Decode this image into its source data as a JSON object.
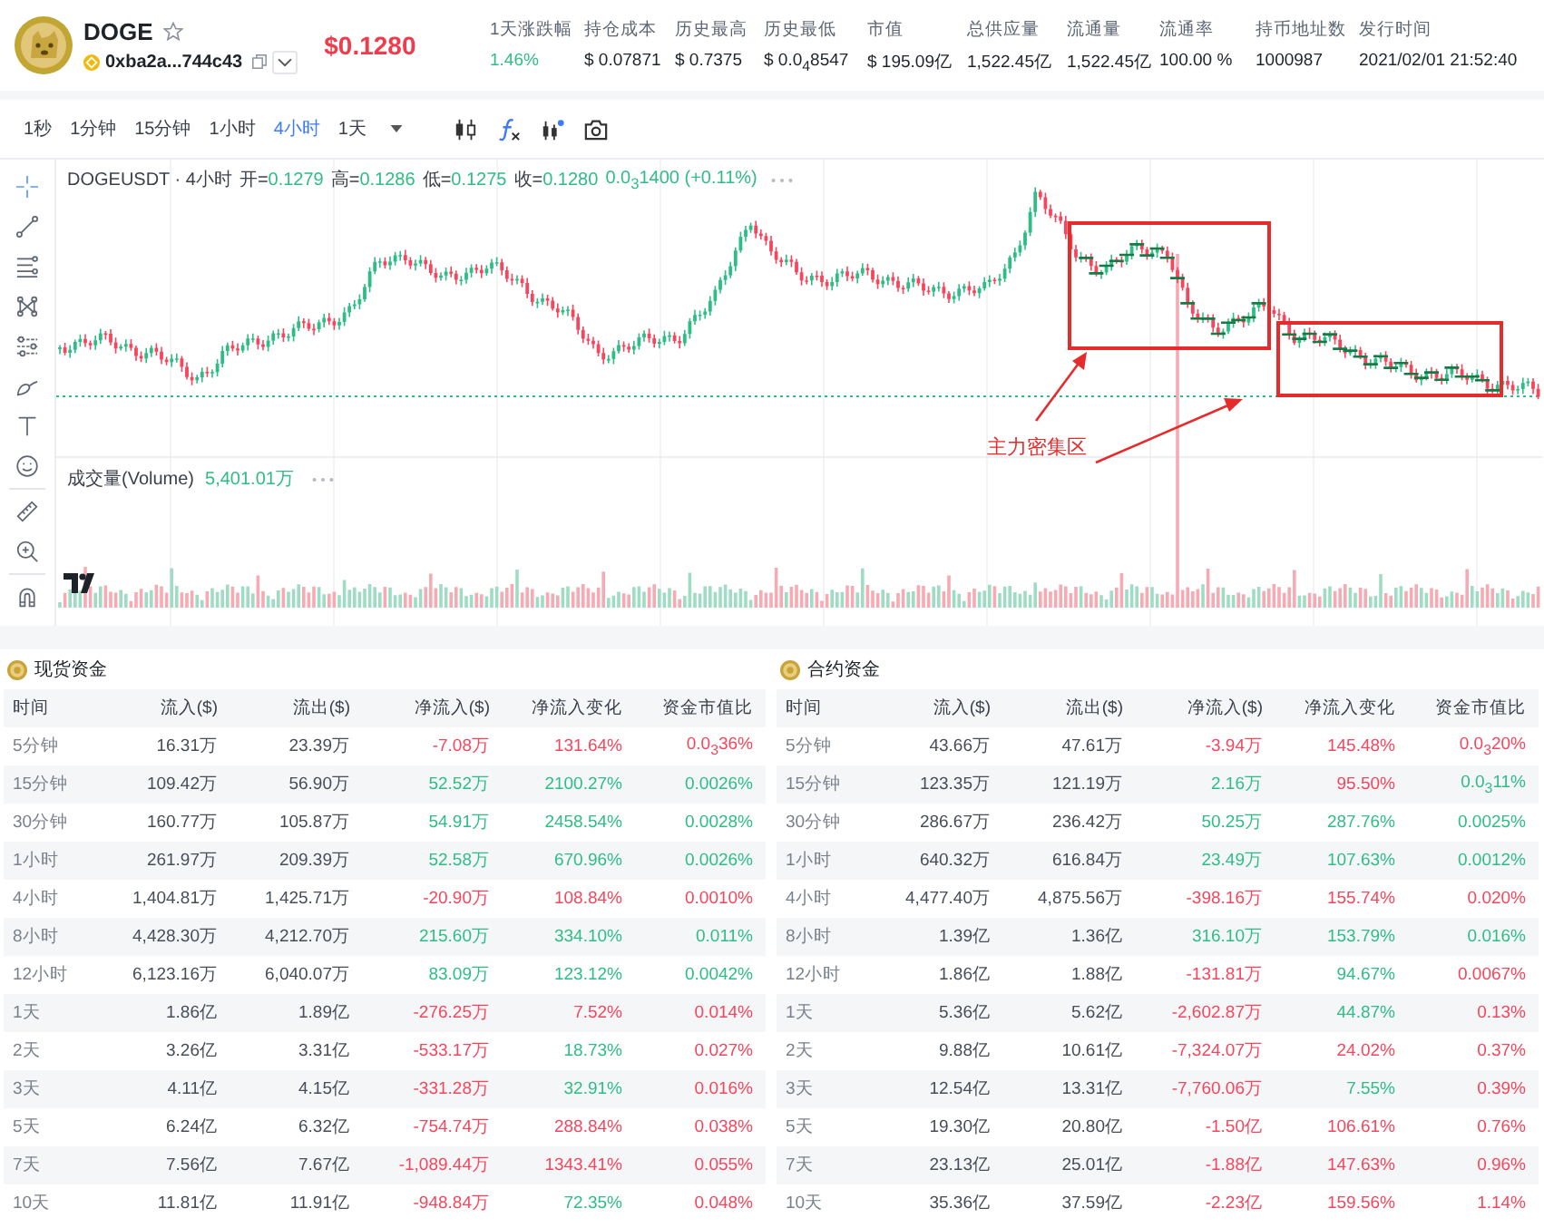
{
  "coin": {
    "symbol": "DOGE",
    "address": "0xba2a...744c43",
    "price": "$0.1280"
  },
  "stats": [
    {
      "label": "1天涨跌幅",
      "value": "1.46%",
      "color": "#2ebd85"
    },
    {
      "label": "持仓成本",
      "value": "$ 0.07871",
      "color": "#1e2329"
    },
    {
      "label": "历史最高",
      "value": "$ 0.7375",
      "color": "#1e2329"
    },
    {
      "label": "历史最低",
      "value": "$ 0.0$_{4}$8547",
      "color": "#1e2329"
    },
    {
      "label": "市值",
      "value": "$ 195.09亿",
      "color": "#1e2329"
    },
    {
      "label": "总供应量",
      "value": "1,522.45亿",
      "color": "#1e2329"
    },
    {
      "label": "流通量",
      "value": "1,522.45亿",
      "color": "#1e2329"
    },
    {
      "label": "流通率",
      "value": "100.00 %",
      "color": "#1e2329"
    },
    {
      "label": "持币地址数",
      "value": "1000987",
      "color": "#1e2329"
    },
    {
      "label": "发行时间",
      "value": "2021/02/01 21:52:40",
      "color": "#1e2329"
    }
  ],
  "intervals": [
    {
      "label": "1秒",
      "selected": false
    },
    {
      "label": "1分钟",
      "selected": false
    },
    {
      "label": "15分钟",
      "selected": false
    },
    {
      "label": "1小时",
      "selected": false
    },
    {
      "label": "4小时",
      "selected": true
    },
    {
      "label": "1天",
      "selected": false
    }
  ],
  "drawing_tools": [
    {
      "kind": "crosshair",
      "selected": true
    },
    {
      "kind": "trend_line",
      "selected": false
    },
    {
      "kind": "parallel_lines",
      "selected": false
    },
    {
      "kind": "pattern",
      "selected": false
    },
    {
      "kind": "sliders",
      "selected": false
    },
    {
      "kind": "brush",
      "selected": false
    },
    {
      "kind": "text",
      "selected": false
    },
    {
      "kind": "emoji",
      "selected": false
    },
    {
      "kind": "ruler",
      "selected": false
    },
    {
      "kind": "zoom",
      "selected": false
    },
    {
      "kind": "magnet",
      "selected": false
    }
  ],
  "chart": {
    "legend": {
      "symbol": "DOGEUSDT · 4小时",
      "fields": [
        {
          "label": "开=",
          "value": "0.1279"
        },
        {
          "label": "高=",
          "value": "0.1286"
        },
        {
          "label": "低=",
          "value": "0.1275"
        },
        {
          "label": "收=",
          "value": "0.1280"
        }
      ],
      "change": "0.0$_{3}$1400 (+0.11%)"
    },
    "volume": {
      "label": "成交量(Volume)",
      "value": "5,401.01万"
    },
    "annotation": "主力密集区"
  },
  "tables": [
    {
      "title": "现货资金",
      "columns": [
        "时间",
        "流入($)",
        "流出($)",
        "净流入($)",
        "净流入变化",
        "资金市值比"
      ],
      "rows": [
        {
          "time": "5分钟",
          "inflow": "16.31万",
          "outflow": "23.39万",
          "net": {
            "text": "-7.08万",
            "color": "#f6465d"
          },
          "change": {
            "text": "131.64%",
            "color": "#f6465d"
          },
          "ratio": {
            "text": "0.0$_{3}$36%",
            "color": "#f6465d"
          }
        },
        {
          "time": "15分钟",
          "inflow": "109.42万",
          "outflow": "56.90万",
          "net": {
            "text": "52.52万",
            "color": "#2ebd85"
          },
          "change": {
            "text": "2100.27%",
            "color": "#2ebd85"
          },
          "ratio": {
            "text": "0.0026%",
            "color": "#2ebd85"
          }
        },
        {
          "time": "30分钟",
          "inflow": "160.77万",
          "outflow": "105.87万",
          "net": {
            "text": "54.91万",
            "color": "#2ebd85"
          },
          "change": {
            "text": "2458.54%",
            "color": "#2ebd85"
          },
          "ratio": {
            "text": "0.0028%",
            "color": "#2ebd85"
          }
        },
        {
          "time": "1小时",
          "inflow": "261.97万",
          "outflow": "209.39万",
          "net": {
            "text": "52.58万",
            "color": "#2ebd85"
          },
          "change": {
            "text": "670.96%",
            "color": "#2ebd85"
          },
          "ratio": {
            "text": "0.0026%",
            "color": "#2ebd85"
          }
        },
        {
          "time": "4小时",
          "inflow": "1,404.81万",
          "outflow": "1,425.71万",
          "net": {
            "text": "-20.90万",
            "color": "#f6465d"
          },
          "change": {
            "text": "108.84%",
            "color": "#f6465d"
          },
          "ratio": {
            "text": "0.0010%",
            "color": "#f6465d"
          }
        },
        {
          "time": "8小时",
          "inflow": "4,428.30万",
          "outflow": "4,212.70万",
          "net": {
            "text": "215.60万",
            "color": "#2ebd85"
          },
          "change": {
            "text": "334.10%",
            "color": "#2ebd85"
          },
          "ratio": {
            "text": "0.011%",
            "color": "#2ebd85"
          }
        },
        {
          "time": "12小时",
          "inflow": "6,123.16万",
          "outflow": "6,040.07万",
          "net": {
            "text": "83.09万",
            "color": "#2ebd85"
          },
          "change": {
            "text": "123.12%",
            "color": "#2ebd85"
          },
          "ratio": {
            "text": "0.0042%",
            "color": "#2ebd85"
          }
        },
        {
          "time": "1天",
          "inflow": "1.86亿",
          "outflow": "1.89亿",
          "net": {
            "text": "-276.25万",
            "color": "#f6465d"
          },
          "change": {
            "text": "7.52%",
            "color": "#f6465d"
          },
          "ratio": {
            "text": "0.014%",
            "color": "#f6465d"
          }
        },
        {
          "time": "2天",
          "inflow": "3.26亿",
          "outflow": "3.31亿",
          "net": {
            "text": "-533.17万",
            "color": "#f6465d"
          },
          "change": {
            "text": "18.73%",
            "color": "#2ebd85"
          },
          "ratio": {
            "text": "0.027%",
            "color": "#f6465d"
          }
        },
        {
          "time": "3天",
          "inflow": "4.11亿",
          "outflow": "4.15亿",
          "net": {
            "text": "-331.28万",
            "color": "#f6465d"
          },
          "change": {
            "text": "32.91%",
            "color": "#2ebd85"
          },
          "ratio": {
            "text": "0.016%",
            "color": "#f6465d"
          }
        },
        {
          "time": "5天",
          "inflow": "6.24亿",
          "outflow": "6.32亿",
          "net": {
            "text": "-754.74万",
            "color": "#f6465d"
          },
          "change": {
            "text": "288.84%",
            "color": "#f6465d"
          },
          "ratio": {
            "text": "0.038%",
            "color": "#f6465d"
          }
        },
        {
          "time": "7天",
          "inflow": "7.56亿",
          "outflow": "7.67亿",
          "net": {
            "text": "-1,089.44万",
            "color": "#f6465d"
          },
          "change": {
            "text": "1343.41%",
            "color": "#f6465d"
          },
          "ratio": {
            "text": "0.055%",
            "color": "#f6465d"
          }
        },
        {
          "time": "10天",
          "inflow": "11.81亿",
          "outflow": "11.91亿",
          "net": {
            "text": "-948.84万",
            "color": "#f6465d"
          },
          "change": {
            "text": "72.35%",
            "color": "#2ebd85"
          },
          "ratio": {
            "text": "0.048%",
            "color": "#f6465d"
          }
        }
      ]
    },
    {
      "title": "合约资金",
      "columns": [
        "时间",
        "流入($)",
        "流出($)",
        "净流入($)",
        "净流入变化",
        "资金市值比"
      ],
      "rows": [
        {
          "time": "5分钟",
          "inflow": "43.66万",
          "outflow": "47.61万",
          "net": {
            "text": "-3.94万",
            "color": "#f6465d"
          },
          "change": {
            "text": "145.48%",
            "color": "#f6465d"
          },
          "ratio": {
            "text": "0.0$_{3}$20%",
            "color": "#f6465d"
          }
        },
        {
          "time": "15分钟",
          "inflow": "123.35万",
          "outflow": "121.19万",
          "net": {
            "text": "2.16万",
            "color": "#2ebd85"
          },
          "change": {
            "text": "95.50%",
            "color": "#f6465d"
          },
          "ratio": {
            "text": "0.0$_{3}$11%",
            "color": "#2ebd85"
          }
        },
        {
          "time": "30分钟",
          "inflow": "286.67万",
          "outflow": "236.42万",
          "net": {
            "text": "50.25万",
            "color": "#2ebd85"
          },
          "change": {
            "text": "287.76%",
            "color": "#2ebd85"
          },
          "ratio": {
            "text": "0.0025%",
            "color": "#2ebd85"
          }
        },
        {
          "time": "1小时",
          "inflow": "640.32万",
          "outflow": "616.84万",
          "net": {
            "text": "23.49万",
            "color": "#2ebd85"
          },
          "change": {
            "text": "107.63%",
            "color": "#2ebd85"
          },
          "ratio": {
            "text": "0.0012%",
            "color": "#2ebd85"
          }
        },
        {
          "time": "4小时",
          "inflow": "4,477.40万",
          "outflow": "4,875.56万",
          "net": {
            "text": "-398.16万",
            "color": "#f6465d"
          },
          "change": {
            "text": "155.74%",
            "color": "#f6465d"
          },
          "ratio": {
            "text": "0.020%",
            "color": "#f6465d"
          }
        },
        {
          "time": "8小时",
          "inflow": "1.39亿",
          "outflow": "1.36亿",
          "net": {
            "text": "316.10万",
            "color": "#2ebd85"
          },
          "change": {
            "text": "153.79%",
            "color": "#2ebd85"
          },
          "ratio": {
            "text": "0.016%",
            "color": "#2ebd85"
          }
        },
        {
          "time": "12小时",
          "inflow": "1.86亿",
          "outflow": "1.88亿",
          "net": {
            "text": "-131.81万",
            "color": "#f6465d"
          },
          "change": {
            "text": "94.67%",
            "color": "#2ebd85"
          },
          "ratio": {
            "text": "0.0067%",
            "color": "#f6465d"
          }
        },
        {
          "time": "1天",
          "inflow": "5.36亿",
          "outflow": "5.62亿",
          "net": {
            "text": "-2,602.87万",
            "color": "#f6465d"
          },
          "change": {
            "text": "44.87%",
            "color": "#2ebd85"
          },
          "ratio": {
            "text": "0.13%",
            "color": "#f6465d"
          }
        },
        {
          "time": "2天",
          "inflow": "9.88亿",
          "outflow": "10.61亿",
          "net": {
            "text": "-7,324.07万",
            "color": "#f6465d"
          },
          "change": {
            "text": "24.02%",
            "color": "#f6465d"
          },
          "ratio": {
            "text": "0.37%",
            "color": "#f6465d"
          }
        },
        {
          "time": "3天",
          "inflow": "12.54亿",
          "outflow": "13.31亿",
          "net": {
            "text": "-7,760.06万",
            "color": "#f6465d"
          },
          "change": {
            "text": "7.55%",
            "color": "#2ebd85"
          },
          "ratio": {
            "text": "0.39%",
            "color": "#f6465d"
          }
        },
        {
          "time": "5天",
          "inflow": "19.30亿",
          "outflow": "20.80亿",
          "net": {
            "text": "-1.50亿",
            "color": "#f6465d"
          },
          "change": {
            "text": "106.61%",
            "color": "#f6465d"
          },
          "ratio": {
            "text": "0.76%",
            "color": "#f6465d"
          }
        },
        {
          "time": "7天",
          "inflow": "23.13亿",
          "outflow": "25.01亿",
          "net": {
            "text": "-1.88亿",
            "color": "#f6465d"
          },
          "change": {
            "text": "147.63%",
            "color": "#f6465d"
          },
          "ratio": {
            "text": "0.96%",
            "color": "#f6465d"
          }
        },
        {
          "time": "10天",
          "inflow": "35.36亿",
          "outflow": "37.59亿",
          "net": {
            "text": "-2.23亿",
            "color": "#f6465d"
          },
          "change": {
            "text": "159.56%",
            "color": "#f6465d"
          },
          "ratio": {
            "text": "1.14%",
            "color": "#f6465d"
          }
        }
      ]
    }
  ]
}
